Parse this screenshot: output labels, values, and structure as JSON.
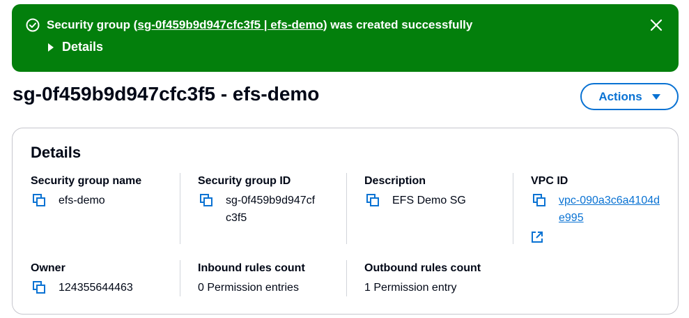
{
  "flash": {
    "prefix": "Security group (",
    "link_text": "sg-0f459b9d947cfc3f5 | efs-demo",
    "suffix": ") was created successfully",
    "details_label": "Details",
    "icon": "success-check-icon",
    "close_icon": "close-icon",
    "color": "#037f0c"
  },
  "header": {
    "title": "sg-0f459b9d947cfc3f5 - efs-demo",
    "actions_label": "Actions"
  },
  "details": {
    "title": "Details",
    "fields": {
      "sg_name": {
        "label": "Security group name",
        "value": "efs-demo"
      },
      "sg_id": {
        "label": "Security group ID",
        "value": "sg-0f459b9d947cfc3f5"
      },
      "description": {
        "label": "Description",
        "value": "EFS Demo SG"
      },
      "vpc_id": {
        "label": "VPC ID",
        "value": "vpc-090a3c6a4104de995"
      },
      "owner": {
        "label": "Owner",
        "value": "124355644463"
      },
      "inbound": {
        "label": "Inbound rules count",
        "value": "0 Permission entries"
      },
      "outbound": {
        "label": "Outbound rules count",
        "value": "1 Permission entry"
      }
    }
  },
  "colors": {
    "accent": "#0972d3",
    "text": "#000716"
  }
}
